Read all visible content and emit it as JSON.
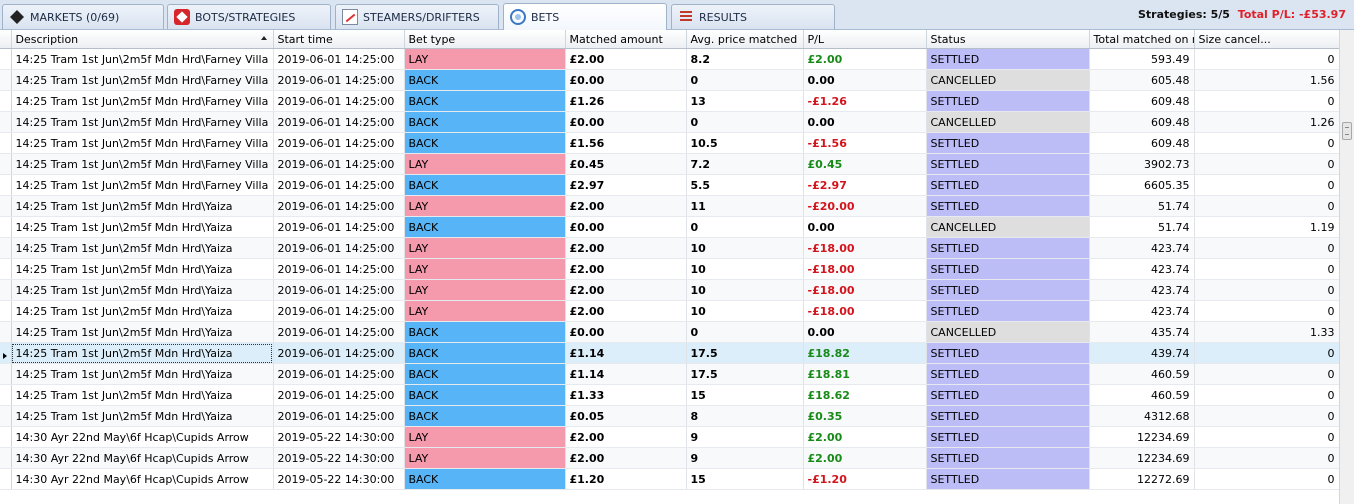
{
  "tabs": [
    {
      "label": "MARKETS (0/69)",
      "icon": "markets-icon"
    },
    {
      "label": "BOTS/STRATEGIES",
      "icon": "bots-icon"
    },
    {
      "label": "STEAMERS/DRIFTERS",
      "icon": "steamers-icon"
    },
    {
      "label": "BETS",
      "icon": "bets-icon"
    },
    {
      "label": "RESULTS",
      "icon": "results-icon"
    }
  ],
  "header": {
    "strategies": "Strategies: 5/5",
    "total_pl": "Total P/L: -£53.97"
  },
  "columns": [
    "Description",
    "Start time",
    "Bet type",
    "Matched amount",
    "Avg. price matched",
    "P/L",
    "Status",
    "Total matched on runner",
    "Size cancel..."
  ],
  "rows": [
    {
      "desc": "14:25 Tram  1st Jun\\2m5f Mdn Hrd\\Farney Villa",
      "start": "2019-06-01 14:25:00",
      "type": "LAY",
      "amount": "£2.00",
      "price": "8.2",
      "pl": "£2.00",
      "status": "SETTLED",
      "total": "593.49",
      "cancel": "0"
    },
    {
      "desc": "14:25 Tram  1st Jun\\2m5f Mdn Hrd\\Farney Villa",
      "start": "2019-06-01 14:25:00",
      "type": "BACK",
      "amount": "£0.00",
      "price": "0",
      "pl": "0.00",
      "status": "CANCELLED",
      "total": "605.48",
      "cancel": "1.56"
    },
    {
      "desc": "14:25 Tram  1st Jun\\2m5f Mdn Hrd\\Farney Villa",
      "start": "2019-06-01 14:25:00",
      "type": "BACK",
      "amount": "£1.26",
      "price": "13",
      "pl": "-£1.26",
      "status": "SETTLED",
      "total": "609.48",
      "cancel": "0"
    },
    {
      "desc": "14:25 Tram  1st Jun\\2m5f Mdn Hrd\\Farney Villa",
      "start": "2019-06-01 14:25:00",
      "type": "BACK",
      "amount": "£0.00",
      "price": "0",
      "pl": "0.00",
      "status": "CANCELLED",
      "total": "609.48",
      "cancel": "1.26"
    },
    {
      "desc": "14:25 Tram  1st Jun\\2m5f Mdn Hrd\\Farney Villa",
      "start": "2019-06-01 14:25:00",
      "type": "BACK",
      "amount": "£1.56",
      "price": "10.5",
      "pl": "-£1.56",
      "status": "SETTLED",
      "total": "609.48",
      "cancel": "0"
    },
    {
      "desc": "14:25 Tram  1st Jun\\2m5f Mdn Hrd\\Farney Villa",
      "start": "2019-06-01 14:25:00",
      "type": "LAY",
      "amount": "£0.45",
      "price": "7.2",
      "pl": "£0.45",
      "status": "SETTLED",
      "total": "3902.73",
      "cancel": "0"
    },
    {
      "desc": "14:25 Tram  1st Jun\\2m5f Mdn Hrd\\Farney Villa",
      "start": "2019-06-01 14:25:00",
      "type": "BACK",
      "amount": "£2.97",
      "price": "5.5",
      "pl": "-£2.97",
      "status": "SETTLED",
      "total": "6605.35",
      "cancel": "0"
    },
    {
      "desc": "14:25 Tram  1st Jun\\2m5f Mdn Hrd\\Yaiza",
      "start": "2019-06-01 14:25:00",
      "type": "LAY",
      "amount": "£2.00",
      "price": "11",
      "pl": "-£20.00",
      "status": "SETTLED",
      "total": "51.74",
      "cancel": "0"
    },
    {
      "desc": "14:25 Tram  1st Jun\\2m5f Mdn Hrd\\Yaiza",
      "start": "2019-06-01 14:25:00",
      "type": "BACK",
      "amount": "£0.00",
      "price": "0",
      "pl": "0.00",
      "status": "CANCELLED",
      "total": "51.74",
      "cancel": "1.19"
    },
    {
      "desc": "14:25 Tram  1st Jun\\2m5f Mdn Hrd\\Yaiza",
      "start": "2019-06-01 14:25:00",
      "type": "LAY",
      "amount": "£2.00",
      "price": "10",
      "pl": "-£18.00",
      "status": "SETTLED",
      "total": "423.74",
      "cancel": "0"
    },
    {
      "desc": "14:25 Tram  1st Jun\\2m5f Mdn Hrd\\Yaiza",
      "start": "2019-06-01 14:25:00",
      "type": "LAY",
      "amount": "£2.00",
      "price": "10",
      "pl": "-£18.00",
      "status": "SETTLED",
      "total": "423.74",
      "cancel": "0"
    },
    {
      "desc": "14:25 Tram  1st Jun\\2m5f Mdn Hrd\\Yaiza",
      "start": "2019-06-01 14:25:00",
      "type": "LAY",
      "amount": "£2.00",
      "price": "10",
      "pl": "-£18.00",
      "status": "SETTLED",
      "total": "423.74",
      "cancel": "0"
    },
    {
      "desc": "14:25 Tram  1st Jun\\2m5f Mdn Hrd\\Yaiza",
      "start": "2019-06-01 14:25:00",
      "type": "LAY",
      "amount": "£2.00",
      "price": "10",
      "pl": "-£18.00",
      "status": "SETTLED",
      "total": "423.74",
      "cancel": "0"
    },
    {
      "desc": "14:25 Tram  1st Jun\\2m5f Mdn Hrd\\Yaiza",
      "start": "2019-06-01 14:25:00",
      "type": "BACK",
      "amount": "£0.00",
      "price": "0",
      "pl": "0.00",
      "status": "CANCELLED",
      "total": "435.74",
      "cancel": "1.33"
    },
    {
      "desc": "14:25 Tram  1st Jun\\2m5f Mdn Hrd\\Yaiza",
      "start": "2019-06-01 14:25:00",
      "type": "BACK",
      "amount": "£1.14",
      "price": "17.5",
      "pl": "£18.82",
      "status": "SETTLED",
      "total": "439.74",
      "cancel": "0",
      "selected": true
    },
    {
      "desc": "14:25 Tram  1st Jun\\2m5f Mdn Hrd\\Yaiza",
      "start": "2019-06-01 14:25:00",
      "type": "BACK",
      "amount": "£1.14",
      "price": "17.5",
      "pl": "£18.81",
      "status": "SETTLED",
      "total": "460.59",
      "cancel": "0"
    },
    {
      "desc": "14:25 Tram  1st Jun\\2m5f Mdn Hrd\\Yaiza",
      "start": "2019-06-01 14:25:00",
      "type": "BACK",
      "amount": "£1.33",
      "price": "15",
      "pl": "£18.62",
      "status": "SETTLED",
      "total": "460.59",
      "cancel": "0"
    },
    {
      "desc": "14:25 Tram  1st Jun\\2m5f Mdn Hrd\\Yaiza",
      "start": "2019-06-01 14:25:00",
      "type": "BACK",
      "amount": "£0.05",
      "price": "8",
      "pl": "£0.35",
      "status": "SETTLED",
      "total": "4312.68",
      "cancel": "0"
    },
    {
      "desc": "14:30 Ayr  22nd May\\6f Hcap\\Cupids Arrow",
      "start": "2019-05-22 14:30:00",
      "type": "LAY",
      "amount": "£2.00",
      "price": "9",
      "pl": "£2.00",
      "status": "SETTLED",
      "total": "12234.69",
      "cancel": "0"
    },
    {
      "desc": "14:30 Ayr  22nd May\\6f Hcap\\Cupids Arrow",
      "start": "2019-05-22 14:30:00",
      "type": "LAY",
      "amount": "£2.00",
      "price": "9",
      "pl": "£2.00",
      "status": "SETTLED",
      "total": "12234.69",
      "cancel": "0"
    },
    {
      "desc": "14:30 Ayr  22nd May\\6f Hcap\\Cupids Arrow",
      "start": "2019-05-22 14:30:00",
      "type": "BACK",
      "amount": "£1.20",
      "price": "15",
      "pl": "-£1.20",
      "status": "SETTLED",
      "total": "12272.69",
      "cancel": "0"
    }
  ]
}
